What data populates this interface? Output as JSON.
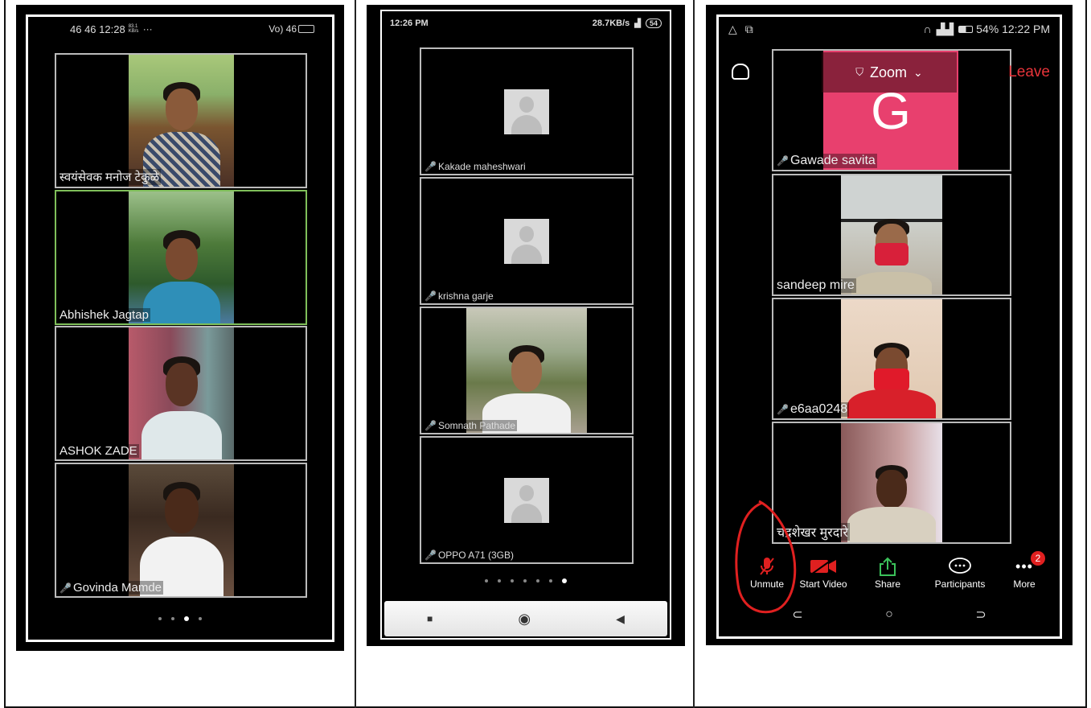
{
  "phone1": {
    "status": {
      "left": "46 46 12:28",
      "left_small": "83.1 KB/s",
      "dots": "···",
      "right": "Vo) 46"
    },
    "tiles": [
      {
        "name": "स्वयंसेवक मनोज टेकुळे",
        "muted": false
      },
      {
        "name": "Abhishek Jagtap",
        "muted": false
      },
      {
        "name": "ASHOK ZADE",
        "muted": false
      },
      {
        "name": "Govinda Mamde",
        "muted": true
      }
    ],
    "page_count": 4,
    "active_page": 3
  },
  "phone2": {
    "status": {
      "time": "12:26 PM",
      "right": "28.7KB/s",
      "battery": "54"
    },
    "tiles": [
      {
        "name": "Kakade maheshwari",
        "muted": true,
        "avatar": true
      },
      {
        "name": "krishna garje",
        "muted": true,
        "avatar": true
      },
      {
        "name": "Somnath Pathade",
        "muted": true,
        "avatar": false
      },
      {
        "name": "OPPO A71 (3GB)",
        "muted": true,
        "avatar": true
      }
    ],
    "page_count": 7,
    "active_page": 7,
    "nav": {
      "recent": "■",
      "home": "◉",
      "back": "◀"
    }
  },
  "phone3": {
    "status": {
      "right": "54% 12:22 PM"
    },
    "header": {
      "title": "Zoom",
      "leave": "Leave",
      "chevron": "⌄"
    },
    "tiles": [
      {
        "name": "Gawade savita",
        "muted": true,
        "letter": "G"
      },
      {
        "name": "sandeep mire",
        "muted": false
      },
      {
        "name": "e6aa0248",
        "muted": true
      },
      {
        "name": "चंद्रशेखर मुरदारे",
        "muted": false
      }
    ],
    "toolbar": {
      "unmute": "Unmute",
      "start_video": "Start Video",
      "share": "Share",
      "participants": "Participants",
      "more": "More",
      "more_badge": "2"
    },
    "nav": {
      "back": "⊂",
      "home": "○",
      "recent": "⊃"
    }
  },
  "colors": {
    "zoom_pink": "#e8406e",
    "leave_red": "#e8343a",
    "share_green": "#3bc15a",
    "annotation_red": "#e02020"
  }
}
